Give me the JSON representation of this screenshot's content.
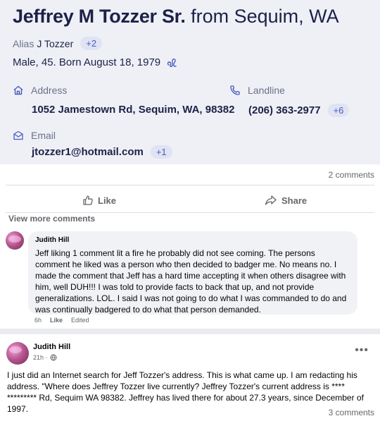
{
  "profile": {
    "name": "Jeffrey M Tozzer Sr.",
    "from": "from Sequim, WA",
    "alias_label": "Alias",
    "alias_value": "J Tozzer",
    "alias_more": "+2",
    "info": "Male, 45. Born August 18, 1979",
    "address_label": "Address",
    "address_value": "1052 Jamestown Rd, Sequim, WA, 98382",
    "landline_label": "Landline",
    "landline_value": "(206) 363-2977",
    "landline_more": "+6",
    "email_label": "Email",
    "email_value": "jtozzer1@hotmail.com",
    "email_more": "+1",
    "accent": "#4a5bbf"
  },
  "post": {
    "comment_count": "2 comments",
    "like_label": "Like",
    "share_label": "Share",
    "view_more": "View more comments",
    "comment": {
      "author": "Judith Hill",
      "text": "Jeff liking 1 comment lit a fire he probably did not see coming. The persons comment he liked was a person who then decided to badger me. No means no. I made the comment that Jeff has a hard time accepting it when others disagree with him, well DUH!!! I was told to provide facts to back that up, and not provide generalizations. LOL. I said I was not going to do what I was commanded to do and was continually badgered to do what that person demanded.",
      "time": "6h",
      "like": "Like",
      "edited": "Edited"
    }
  },
  "post2": {
    "author": "Judith Hill",
    "time": "21h ·",
    "menu": "•••",
    "text": "I just did an Internet search for Jeff Tozzer's address. This is what came up. I am redacting his address. \"Where does Jeffrey Tozzer live currently? Jeffrey Tozzer's current address is **** ********* Rd, Sequim WA 98382. Jeffrey has lived there for about 27.3 years, since December of 1997.",
    "comment_count": "3 comments"
  }
}
